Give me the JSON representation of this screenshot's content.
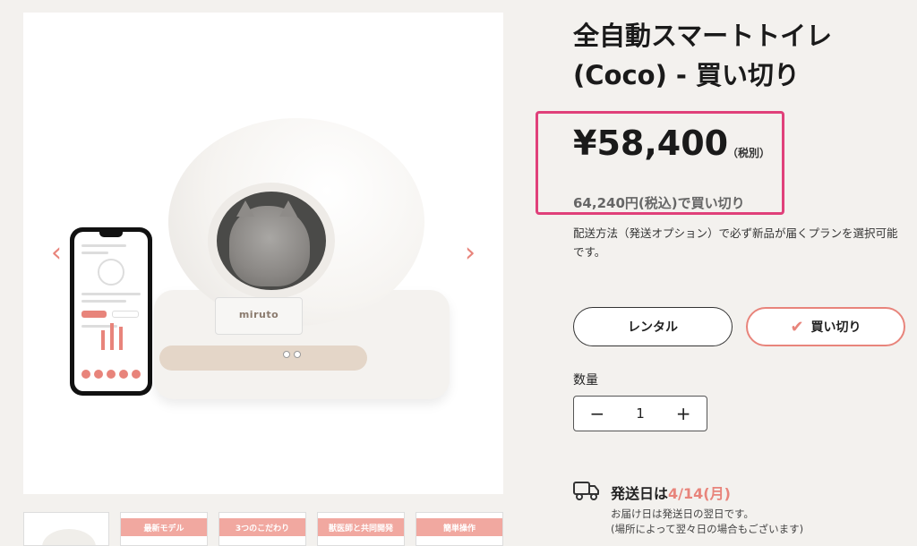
{
  "product": {
    "title_line1": "全自動スマートトイレ",
    "title_line2": "(Coco) - 買い切り",
    "price": "¥58,400",
    "tax_note": "（税別）",
    "incl_price": "64,240円(税込)で買い切り",
    "delivery_note": "配送方法（発送オプション）で必ず新品が届くプランを選択可能です。",
    "brand": "miruto"
  },
  "options": {
    "rental_label": "レンタル",
    "buy_label": "買い切り",
    "selected": "買い切り"
  },
  "quantity": {
    "label": "数量",
    "minus": "−",
    "value": "1",
    "plus": "+"
  },
  "shipping": {
    "title_prefix": "発送日は",
    "date": "4/14(月)",
    "note_line1": "お届け日は発送日の翌日です。",
    "note_line2": "(場所によって翌々日の場合もございます)"
  },
  "gallery": {
    "prev": "‹",
    "next": "›",
    "thumbnails": [
      "",
      "最新モデル",
      "3つのこだわり",
      "獣医師と共同開発",
      "簡単操作"
    ]
  },
  "colors": {
    "accent": "#e8847b",
    "highlight_border": "#e0407a"
  }
}
